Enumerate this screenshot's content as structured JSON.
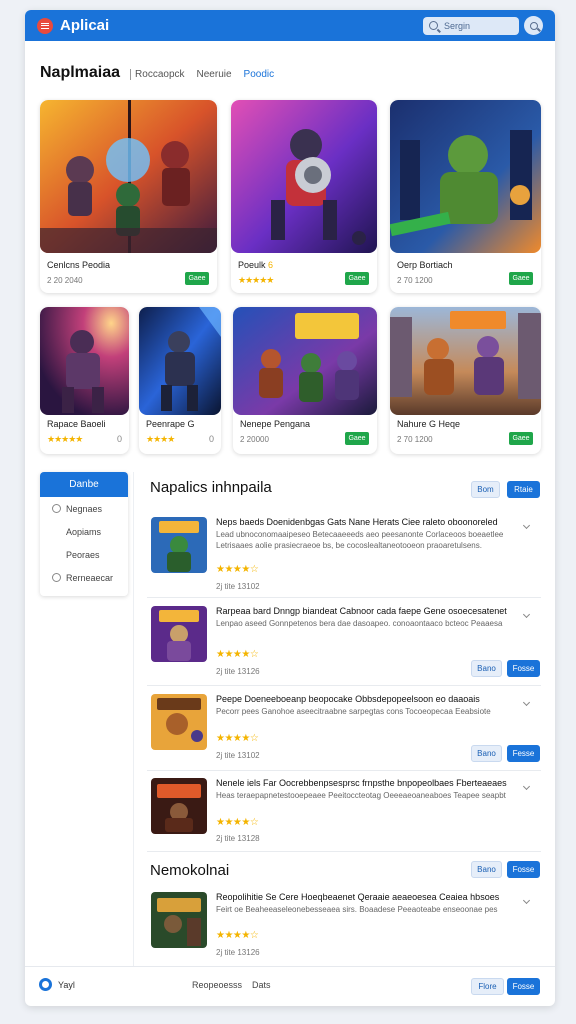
{
  "app": {
    "title": "Aplicai"
  },
  "search": {
    "placeholder": "Sergin"
  },
  "header": {
    "title": "Naplmaiaa",
    "breadcrumbs": [
      "Roccaopck",
      "Neeruie",
      "Poodic"
    ]
  },
  "featured": [
    {
      "title": "Cenlcns Peodia",
      "meta": "2 20 2040",
      "get": "Gaee"
    },
    {
      "title": "Poeulk",
      "badge": "6",
      "stars": "★★★★★",
      "get": "Gaee"
    },
    {
      "title": "Oerp Bortiach",
      "meta": "2 70 1200",
      "get": "Gaee"
    }
  ],
  "games_row2": [
    {
      "title": "Rapace Baoeli",
      "stars": "★★★★★",
      "count": "0"
    },
    {
      "title": "Peenrape G",
      "stars": "★★★★",
      "count": "0"
    },
    {
      "title": "Nenepe Pengana",
      "meta": "2 20000",
      "get": "Gaee"
    },
    {
      "title": "Nahure G Heqe",
      "meta": "2 70 1200",
      "get": "Gaee"
    }
  ],
  "sidebar": {
    "header": "Danbe",
    "items": [
      "Negnaes",
      "Aopiams",
      "Peoraes",
      "Rerneaecar"
    ]
  },
  "list_section": {
    "title": "Napalics inhnpaila",
    "btn_light": "Bom",
    "btn_blue": "Rtaie"
  },
  "list": [
    {
      "title": "Neps baeds Doenidenbgas Gats Nane Herats Ciee raleto oboonoreled",
      "desc": "Lead ubnoconomaaipeseo Betecaaeeeds aeo peesanonte Corlaceoos boeaetlee Letrisaaes aolie prasiecraeoe bs, be cocoslealtaneotooeon praoaretulsens.",
      "stars": "★★★★☆",
      "meta": "2j tite  13102"
    },
    {
      "title": "Rarpeaa bard Dnngp biandeat Cabnoor cada faepe Gene osoecesatenet",
      "desc": "Lenpao aseed Gonnpetenos bera dae dasoapeo. conoaontaaco bcteoc Peaaesa",
      "stars": "★★★★☆",
      "meta": "2j tite  13126",
      "btn_light": "Bano",
      "btn_blue": "Fosse"
    },
    {
      "title": "Peepe Doeneeboeanp beopocake Obbsdepopeelsoon eo daaoais",
      "desc": "Pecorr pees Ganohoe aseecitraabne sarpegtas cons Tocoeopecaa Eeabsiote",
      "stars": "★★★★☆",
      "meta": "2j tite  13102",
      "btn_light": "Bano",
      "btn_blue": "Fesse"
    },
    {
      "title": "Nenele iels Far Oocrebbenpsesprsc frnpsthe bnpopeolbaes Fberteaeaes",
      "desc": "Heas teraepapnetestooepeaee Peeitoccteotag Oeeeaeoaneaboes Teapee seapbt",
      "stars": "★★★★☆",
      "meta": "2j tite  13128"
    }
  ],
  "section2": {
    "title": "Nemokolnai",
    "btn_light": "Bano",
    "btn_blue": "Fosse"
  },
  "list2": [
    {
      "title": "Reopolihitie Se Cere Hoeqbeaenet Qeraaie aeaeoesea Ceaiea hbsoes",
      "desc": "Feirt oe Beaheeaseleonebesseaea sirs. Boaadese Peeaoteabe enseoonae pes",
      "stars": "★★★★☆",
      "meta": "2j tite  13126"
    }
  ],
  "footer": {
    "brand": "Yayl",
    "links": [
      "Reopeoesss",
      "Dats"
    ],
    "btn_light": "Flore",
    "btn_blue": "Fosse"
  },
  "colors": {
    "accent": "#1a73d9",
    "get": "#1fa64a",
    "star": "#f4b400",
    "menu": "#e84a3d"
  }
}
